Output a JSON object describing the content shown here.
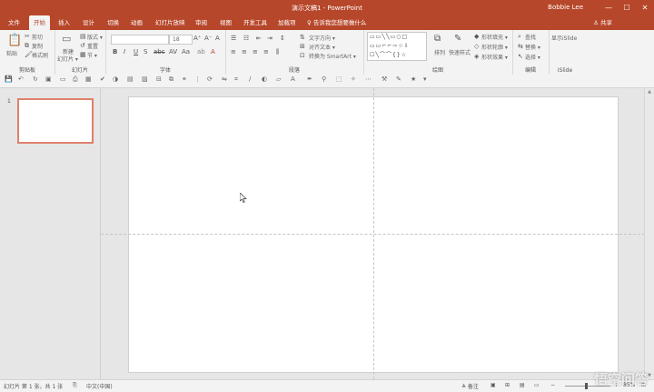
{
  "window": {
    "title": "演示文稿1 - PowerPoint",
    "user": "Bobbie Lee",
    "minimize": "—",
    "maximize": "☐",
    "close": "✕"
  },
  "tabs": [
    "文件",
    "开始",
    "插入",
    "设计",
    "切换",
    "动画",
    "幻灯片放映",
    "审阅",
    "视图",
    "开发工具",
    "加载项"
  ],
  "active_tab": "开始",
  "tellme": "♀ 告诉我您想要做什么",
  "share": "♙ 共享",
  "ribbon": {
    "clipboard": {
      "label": "剪贴板",
      "paste": "粘贴",
      "cut": "剪切",
      "copy": "复制",
      "format_painter": "格式刷"
    },
    "slides": {
      "label": "幻灯片",
      "new_slide": "新建",
      "new_slide2": "幻灯片 ▾",
      "layout": "版式 ▾",
      "reset": "重置",
      "section": "节 ▾"
    },
    "font": {
      "label": "字体",
      "size": "18"
    },
    "paragraph": {
      "label": "段落",
      "text_direction": "文字方向 ▾",
      "align_text": "对齐文本 ▾",
      "smartart": "转换为 SmartArt ▾"
    },
    "drawing": {
      "label": "绘图",
      "arrange": "排列",
      "quick_styles": "快速样式",
      "shape_fill": "形状填充 ▾",
      "shape_outline": "形状轮廓 ▾",
      "shape_effects": "形状效果 ▾"
    },
    "editing": {
      "label": "编辑",
      "find": "查找",
      "replace": "替换 ▾",
      "select": "选择 ▾"
    },
    "islide": {
      "label": "iSlide",
      "show": "显示iSlide"
    }
  },
  "slides_panel": {
    "slide_number": "1"
  },
  "statusbar": {
    "slide_info": "幻灯片 第 1 张，共 1 张",
    "language": "中文(中国)",
    "notes": "≜ 备注",
    "zoom": "85%"
  },
  "watermark": "悟空问答",
  "colors": {
    "accent": "#b7472a",
    "ribbon_bg": "#f3f3f3",
    "workspace": "#e6e6e6"
  }
}
